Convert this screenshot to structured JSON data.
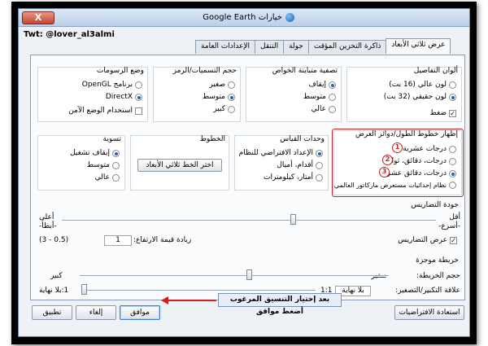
{
  "window": {
    "title": "Google Earth خيارات",
    "close_label": "X",
    "user_label": "Twt: @lover_al3almi"
  },
  "tabs": [
    "عرض ثلاثي الأبعاد",
    "ذاكرة التخزين المؤقت",
    "جولة",
    "التنقل",
    "الإعدادات العامة"
  ],
  "texture_colors": {
    "title": "ألوان التفاصيل",
    "options": [
      "لون عالي (16 بت)",
      "لون حقيقي (32 بت)"
    ],
    "selected": 1,
    "compress_label": "ضغط"
  },
  "anisotropic": {
    "title": "تصفية متباينة الخواص",
    "options": [
      "إيقاف",
      "متوسط",
      "عالي"
    ],
    "selected": 0
  },
  "label_size": {
    "title": "حجم التسميات/الرمز",
    "options": [
      "صغير",
      "متوسط",
      "كبير"
    ],
    "selected": 1
  },
  "graphics_mode": {
    "title": "وضع الرسومات",
    "options": [
      "برنامج OpenGL",
      "DirectX"
    ],
    "selected": 1,
    "safe_mode_label": "استخدام الوضع الآمن"
  },
  "lat_long": {
    "title": "إظهار خطوط الطول/دوائر العرض",
    "options": [
      "درجات عشرية",
      "درجات، دقائق، ثوان",
      "درجات، دقائق عشرية",
      "نظام إحداثيات مستعرض ماركاتور العالمي"
    ],
    "selected": 2,
    "badges": [
      "1",
      "2",
      "3"
    ]
  },
  "units": {
    "title": "وحدات القياس",
    "options": [
      "الإعداد الافتراضي للنظام",
      "أقدام، أميال",
      "أمتار، كيلومترات"
    ],
    "selected": 0
  },
  "fonts": {
    "title": "الخطوط",
    "button_label": "اختر الخط ثلاثي الأبعاد"
  },
  "smoothing": {
    "title": "تسوية",
    "options": [
      "إيقاف تشغيل",
      "متوسط",
      "عالي"
    ],
    "selected": 0
  },
  "terrain_quality": {
    "title": "جودة التضاريس",
    "left_top": "أعلى",
    "left_bottom": "-أبطأ-",
    "right_top": "أقل",
    "right_bottom": "-أسرع-",
    "elevation_label": "زيادة قيمة الارتفاع:",
    "elevation_value": "1",
    "elevation_range": "(0.5 - 3)",
    "show_terrain_label": "عرض التضاريس",
    "level": 0.38
  },
  "overview_map": {
    "title": "خريطة موجزة",
    "size_label": "حجم الخريطة:",
    "size_small": "صغير",
    "size_large": "كبير",
    "size_level": 0.45,
    "zoom_label": "علاقة التكبير/التصغير:",
    "zoom_left": "1:بلا نهاية",
    "zoom_right": "1:1",
    "zoom_value": "بلا نهاية",
    "zoom_level": 0.0
  },
  "buttons": {
    "restore": "استعادة الافتراضيات",
    "ok": "موافق",
    "cancel": "إلغاء",
    "apply": "تطبيق"
  },
  "annotation": "بعد إختيار التنسيق المرغوب أضغط موافق",
  "colors": {
    "highlight": "#d02020",
    "selected_radio": "#2b5fb3"
  }
}
